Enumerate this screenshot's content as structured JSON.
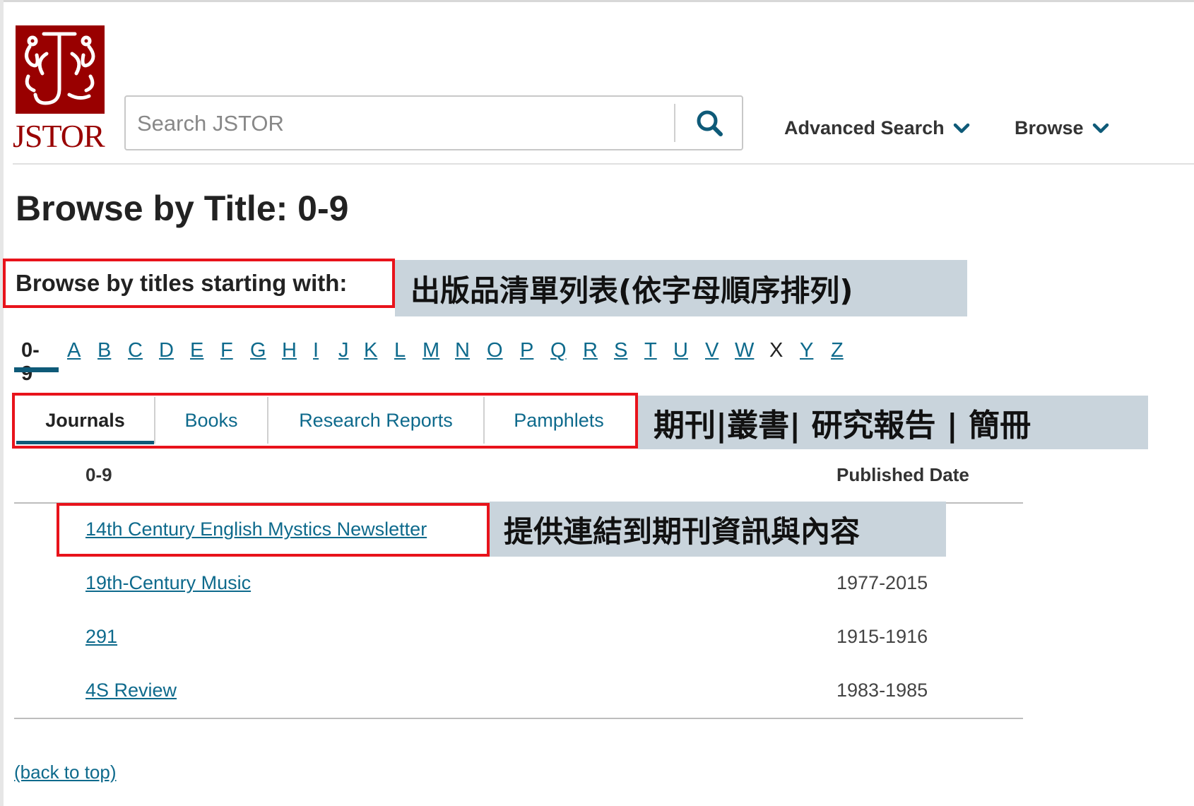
{
  "logo": {
    "wordmark": "JSTOR",
    "icon": "jstor-logo-icon"
  },
  "search": {
    "placeholder": "Search JSTOR",
    "value": "",
    "button_icon": "search-icon"
  },
  "nav": {
    "advanced_search": "Advanced Search",
    "browse": "Browse",
    "chevron_icon": "chevron-down-icon"
  },
  "page_title": "Browse by Title: 0-9",
  "browse_label": "Browse by titles starting with:",
  "annotations": {
    "alphabet_note": "出版品清單列表(依字母順序排列)",
    "tabs_note": "期刊|叢書| 研究報告 | 簡冊",
    "link_note": "提供連結到期刊資訊與內容"
  },
  "letters": [
    "0-9",
    "A",
    "B",
    "C",
    "D",
    "E",
    "F",
    "G",
    "H",
    "I",
    "J",
    "K",
    "L",
    "M",
    "N",
    "O",
    "P",
    "Q",
    "R",
    "S",
    "T",
    "U",
    "V",
    "W",
    "X",
    "Y",
    "Z"
  ],
  "active_letter": "0-9",
  "tabs": [
    "Journals",
    "Books",
    "Research Reports",
    "Pamphlets"
  ],
  "active_tab": "Journals",
  "table": {
    "col_title": "0-9",
    "col_date": "Published Date",
    "rows": [
      {
        "title": "14th Century English Mystics Newsletter",
        "date": ""
      },
      {
        "title": "19th-Century Music",
        "date": "1977-2015"
      },
      {
        "title": "291",
        "date": "1915-1916"
      },
      {
        "title": "4S Review",
        "date": "1983-1985"
      }
    ]
  },
  "back_to_top": "(back to top)",
  "colors": {
    "brand": "#990000",
    "link": "#0e6a8c",
    "annotation_red": "#e8131b",
    "note_bg": "#c9d4dc"
  }
}
